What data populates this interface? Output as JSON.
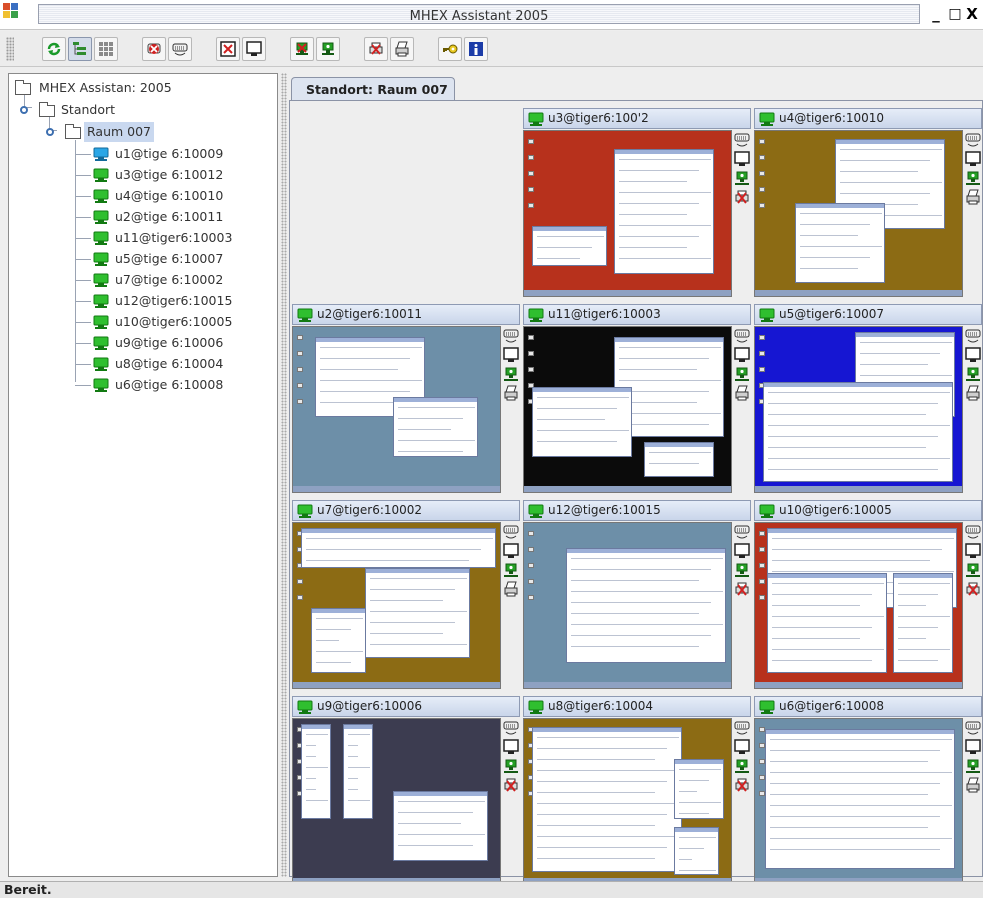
{
  "window": {
    "title": "MHEX Assistant 2005",
    "minimize_glyph": "_",
    "maximize_glyph": "□",
    "close_glyph": "X"
  },
  "toolbar": {
    "buttons": [
      {
        "name": "reconnect-icon",
        "active": false
      },
      {
        "name": "tree-view-icon",
        "active": true
      },
      {
        "name": "grid-view-icon",
        "active": false
      },
      {
        "name": "lock-keyboard-icon",
        "active": false
      },
      {
        "name": "keyboard-icon",
        "active": false
      },
      {
        "name": "screen-off-icon",
        "active": false
      },
      {
        "name": "screen-on-icon",
        "active": false
      },
      {
        "name": "disconnect-network-icon",
        "active": false
      },
      {
        "name": "connect-network-icon",
        "active": false
      },
      {
        "name": "printer-off-icon",
        "active": false
      },
      {
        "name": "printer-icon",
        "active": false
      },
      {
        "name": "key-icon",
        "active": false
      },
      {
        "name": "info-icon",
        "active": false
      }
    ]
  },
  "tree": {
    "root": "MHEX Assistan: 2005",
    "site": "Standort",
    "room": "Raum 007",
    "clients": [
      {
        "label": "u1@tige 6:10009",
        "status": "blue"
      },
      {
        "label": "u3@tige 6:10012",
        "status": "green"
      },
      {
        "label": "u4@tige 6:10010",
        "status": "green"
      },
      {
        "label": "u2@tige 6:10011",
        "status": "green"
      },
      {
        "label": "u11@tiger6:10003",
        "status": "green"
      },
      {
        "label": "u5@tige 6:10007",
        "status": "green"
      },
      {
        "label": "u7@tige 6:10002",
        "status": "green"
      },
      {
        "label": "u12@tiger6:10015",
        "status": "green"
      },
      {
        "label": "u10@tiger6:10005",
        "status": "green"
      },
      {
        "label": "u9@tige 6:10006",
        "status": "green"
      },
      {
        "label": "u8@tige 6:10004",
        "status": "green"
      },
      {
        "label": "u6@tige 6:10008",
        "status": "green"
      }
    ]
  },
  "tab": {
    "label": "Standort: Raum 007"
  },
  "tiles": [
    {
      "label": "u3@tiger6:100'2",
      "bg": "#b7311c",
      "deco": "red-desktop"
    },
    {
      "label": "u4@tiger6:10010",
      "bg": "#8c6b14",
      "deco": "olive-desktop"
    },
    {
      "label": "u2@tiger6:10011",
      "bg": "#6d8fa8",
      "deco": "slate-desktop"
    },
    {
      "label": "u11@tiger6:10003",
      "bg": "#0b0b0b",
      "deco": "black-desktop"
    },
    {
      "label": "u5@tiger6:10007",
      "bg": "#1616d2",
      "deco": "blue-desktop"
    },
    {
      "label": "u7@tiger6:10002",
      "bg": "#8c6b14",
      "deco": "olive-desktop"
    },
    {
      "label": "u12@tiger6:10015",
      "bg": "#6d8fa8",
      "deco": "browser-desktop"
    },
    {
      "label": "u10@tiger6:10005",
      "bg": "#b7311c",
      "deco": "red-desktop"
    },
    {
      "label": "u9@tiger6:10006",
      "bg": "#3c3c50",
      "deco": "dark-desktop"
    },
    {
      "label": "u8@tiger6:10004",
      "bg": "#8c6b14",
      "deco": "olive-desktop"
    },
    {
      "label": "u6@tiger6:10008",
      "bg": "#6d8fa8",
      "deco": "slate-desktop"
    }
  ],
  "tile_side_buttons": [
    "keyboard-icon",
    "monitor-icon",
    "network-icon",
    "printer-icon"
  ],
  "status": {
    "text": "Bereit."
  }
}
